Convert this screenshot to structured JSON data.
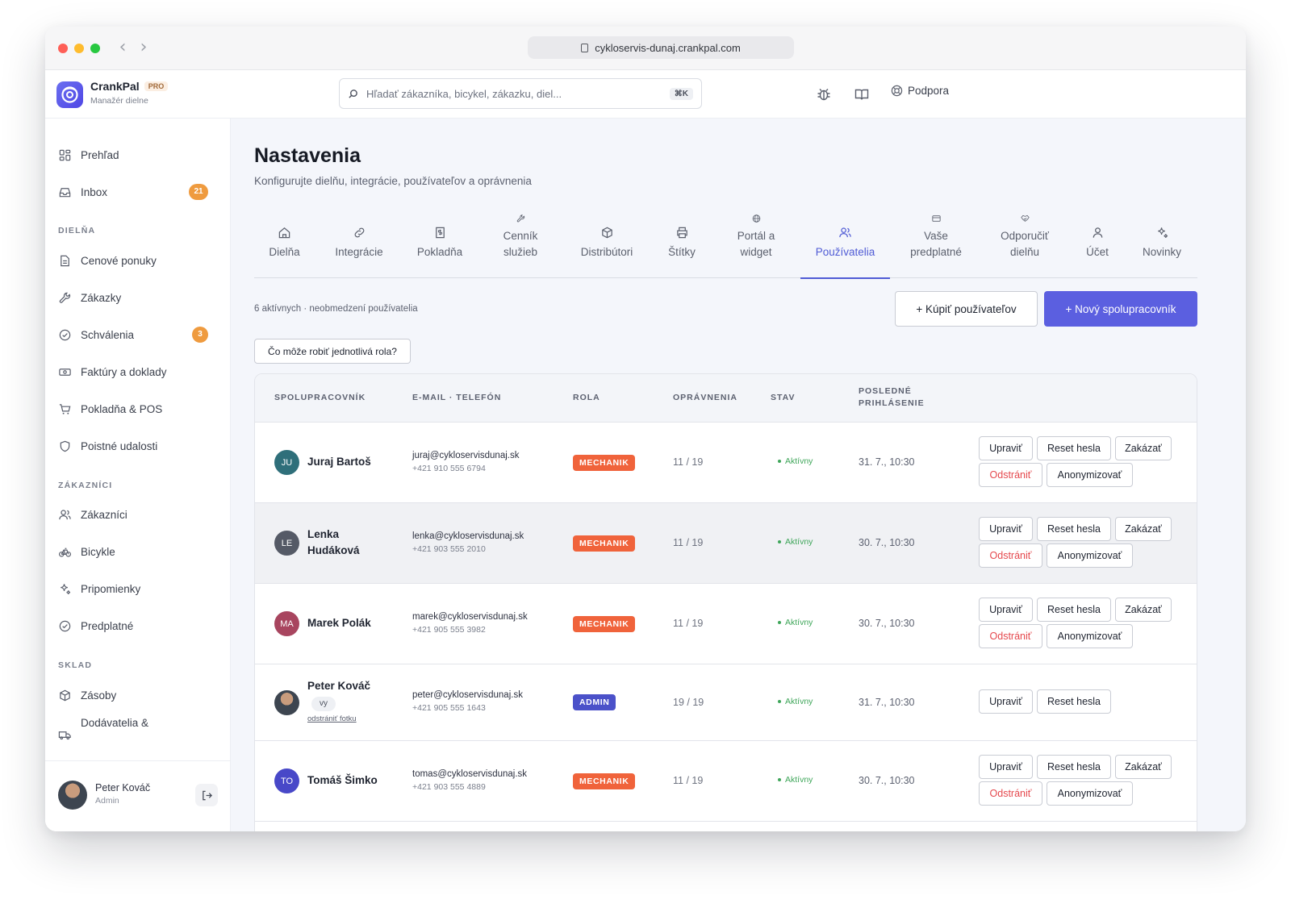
{
  "browser": {
    "url": "cykloservis-dunaj.crankpal.com"
  },
  "app": {
    "name": "CrankPal",
    "plan": "PRO",
    "subtitle": "Manažér dielne",
    "search_placeholder": "Hľadať zákazníka, bicykel, zákazku, diel...",
    "search_shortcut": "⌘K",
    "support_label": "Podpora"
  },
  "sidebar": {
    "top": [
      {
        "label": "Prehľad",
        "icon": "grid-icon"
      },
      {
        "label": "Inbox",
        "icon": "inbox-icon",
        "badge": "21"
      }
    ],
    "sections": [
      {
        "title": "DIELŇA",
        "items": [
          {
            "label": "Cenové ponuky",
            "icon": "document-icon"
          },
          {
            "label": "Zákazky",
            "icon": "wrench-icon"
          },
          {
            "label": "Schválenia",
            "icon": "check-circle-icon",
            "badge": "3"
          },
          {
            "label": "Faktúry a doklady",
            "icon": "cash-icon"
          },
          {
            "label": "Pokladňa & POS",
            "icon": "cart-icon"
          },
          {
            "label": "Poistné udalosti",
            "icon": "shield-icon"
          }
        ]
      },
      {
        "title": "ZÁKAZNÍCI",
        "items": [
          {
            "label": "Zákazníci",
            "icon": "users-icon"
          },
          {
            "label": "Bicykle",
            "icon": "bicycle-icon"
          },
          {
            "label": "Pripomienky",
            "icon": "sparkle-icon"
          },
          {
            "label": "Predplatné",
            "icon": "check-circle-icon"
          }
        ]
      },
      {
        "title": "SKLAD",
        "items": [
          {
            "label": "Zásoby",
            "icon": "box-icon"
          },
          {
            "label": "Dodávatelia &",
            "icon": "truck-icon"
          }
        ]
      }
    ],
    "user": {
      "name": "Peter Kováč",
      "role": "Admin"
    }
  },
  "page": {
    "title": "Nastavenia",
    "subtitle": "Konfigurujte dielňu, integrácie, používateľov a oprávnenia",
    "tabs": [
      {
        "label": "Dielňa",
        "icon": "home-icon"
      },
      {
        "label": "Integrácie",
        "icon": "link-icon"
      },
      {
        "label": "Pokladňa",
        "icon": "receipt-icon"
      },
      {
        "label": "Cenník služieb",
        "icon": "wrench-icon"
      },
      {
        "label": "Distribútori",
        "icon": "box-icon"
      },
      {
        "label": "Štítky",
        "icon": "printer-icon"
      },
      {
        "label": "Portál a widget",
        "icon": "globe-icon"
      },
      {
        "label": "Používatelia",
        "icon": "users-icon",
        "active": true
      },
      {
        "label": "Vaše predplatné",
        "icon": "credit-card-icon"
      },
      {
        "label": "Odporučiť dielňu",
        "icon": "handshake-icon"
      },
      {
        "label": "Účet",
        "icon": "user-icon"
      },
      {
        "label": "Novinky",
        "icon": "sparkle-icon"
      }
    ],
    "user_count": "6 aktívnych · neobmedzení používatelia",
    "buy_users_label": "+ Kúpiť používateľov",
    "new_collaborator_label": "+ Nový spolupracovník",
    "roles_help_label": "Čo môže robiť jednotlivá rola?"
  },
  "table": {
    "headers": {
      "collaborator": "SPOLUPRACOVNÍK",
      "contact": "E-MAIL · TELEFÓN",
      "role": "ROLA",
      "permissions": "OPRÁVNENIA",
      "status": "STAV",
      "last_login_1": "POSLEDNÉ",
      "last_login_2": "PRIHLÁSENIE"
    },
    "action_labels": {
      "edit": "Upraviť",
      "reset": "Reset hesla",
      "disable": "Zakázať",
      "remove": "Odstrániť",
      "anonymize": "Anonymizovať"
    },
    "you_label": "vy",
    "remove_photo_label": "odstrániť fotku",
    "rows": [
      {
        "initials": "JU",
        "name": "Juraj Bartoš",
        "email": "juraj@cykloservisdunaj.sk",
        "phone": "+421 910 555 6794",
        "role": "MECHANIK",
        "permissions": "11 / 19",
        "status": "Aktívny",
        "last_login": "31. 7., 10:30",
        "avatar_color": "#2f6f7a"
      },
      {
        "initials": "LE",
        "name_line1": "Lenka",
        "name_line2": "Hudáková",
        "email": "lenka@cykloservisdunaj.sk",
        "phone": "+421 903 555 2010",
        "role": "MECHANIK",
        "permissions": "11 / 19",
        "status": "Aktívny",
        "last_login": "30. 7., 10:30",
        "avatar_color": "#555a66"
      },
      {
        "initials": "MA",
        "name": "Marek Polák",
        "email": "marek@cykloservisdunaj.sk",
        "phone": "+421 905 555 3982",
        "role": "MECHANIK",
        "permissions": "11 / 19",
        "status": "Aktívny",
        "last_login": "30. 7., 10:30",
        "avatar_color": "#a8455f"
      },
      {
        "name": "Peter Kováč",
        "email": "peter@cykloservisdunaj.sk",
        "phone": "+421 905 555 1643",
        "role": "ADMIN",
        "permissions": "19 / 19",
        "status": "Aktívny",
        "last_login": "31. 7., 10:30"
      },
      {
        "initials": "TO",
        "name": "Tomáš Šimko",
        "email": "tomas@cykloservisdunaj.sk",
        "phone": "+421 903 555 4889",
        "role": "MECHANIK",
        "permissions": "11 / 19",
        "status": "Aktívny",
        "last_login": "30. 7., 10:30",
        "avatar_color": "#4848c8"
      }
    ]
  },
  "colors": {
    "accent": "#5b5fe0",
    "mechanik_badge": "#f0633b",
    "admin_badge": "#4b51c9",
    "active_status": "#3fa65a",
    "sidebar_badge": "#ef9b3f"
  }
}
